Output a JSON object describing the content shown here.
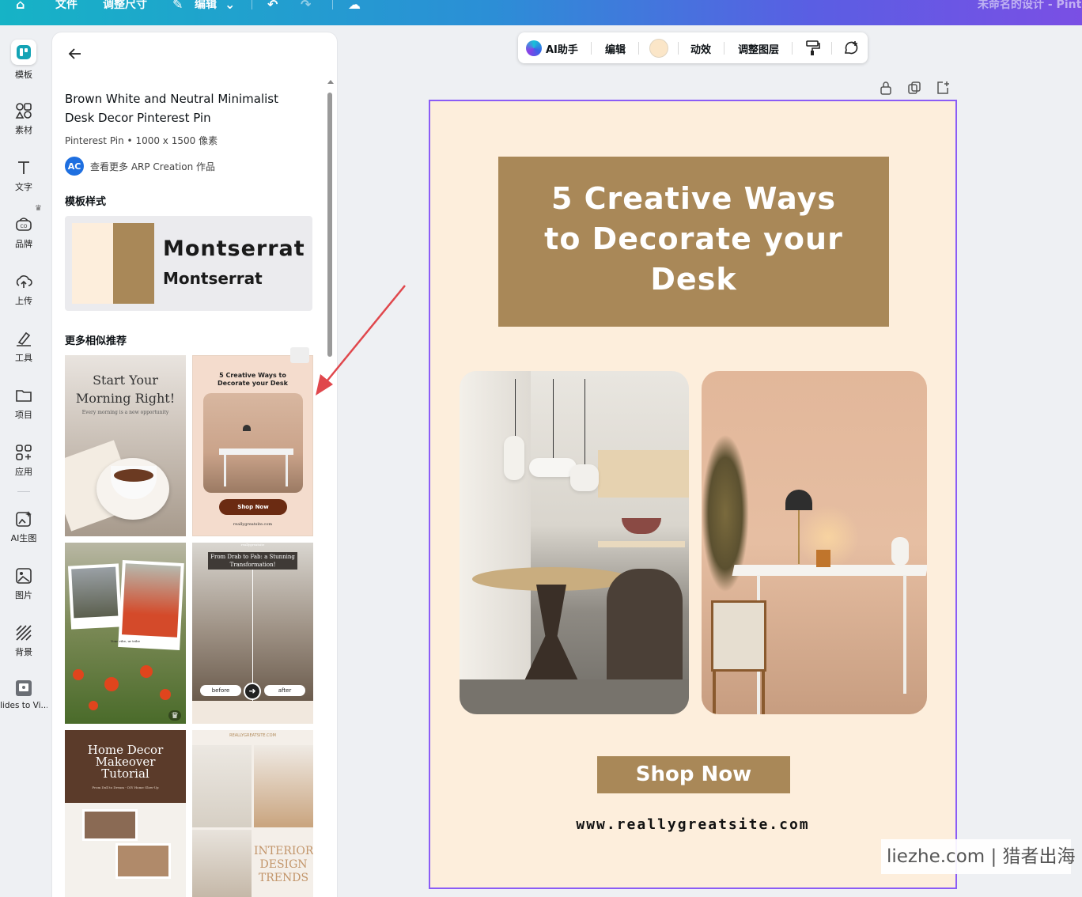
{
  "topbar": {
    "home_icon": "home-icon",
    "file": "文件",
    "resize": "调整尺寸",
    "edit": "编辑",
    "title": "未命名的设计 - Pinte"
  },
  "rail": [
    {
      "label": "模板",
      "icon": "templates-icon",
      "active": true
    },
    {
      "label": "素材",
      "icon": "elements-icon"
    },
    {
      "label": "文字",
      "icon": "text-icon"
    },
    {
      "label": "品牌",
      "icon": "brand-icon"
    },
    {
      "label": "上传",
      "icon": "upload-icon"
    },
    {
      "label": "工具",
      "icon": "tools-icon"
    },
    {
      "label": "项目",
      "icon": "projects-icon"
    },
    {
      "label": "应用",
      "icon": "apps-icon"
    },
    {
      "label": "AI生图",
      "icon": "ai-image-icon"
    },
    {
      "label": "图片",
      "icon": "photos-icon"
    },
    {
      "label": "背景",
      "icon": "background-icon"
    },
    {
      "label": "lides to Vi...",
      "icon": "slides-to-video-icon"
    }
  ],
  "panel": {
    "title": "Brown White and Neutral Minimalist Desk Decor Pinterest Pin",
    "meta": "Pinterest Pin • 1000 x 1500 像素",
    "avatar": "AC",
    "author": "查看更多 ARP Creation 作品",
    "style_heading": "模板样式",
    "font_big": "Montserrat",
    "font_small": "Montserrat",
    "swatches": [
      "#fdeedc",
      "#a98858"
    ],
    "more_heading": "更多相似推荐",
    "thumbs": {
      "t1_title": "Start Your Morning Right!",
      "t1_sub": "Every morning is a new opportunity",
      "t2_title": "5 Creative Ways to Decorate your Desk",
      "t2_btn": "Shop Now",
      "t2_url": "reallygreatsite.com",
      "t3_caption": "Your vibe, ur tribe",
      "t4_tag": "reallygreatsite",
      "t4_title": "From Drab to Fab: a Stunning Transformation!",
      "t4_before": "before",
      "t4_after": "after",
      "t5_title": "Home Decor Makeover Tutorial",
      "t5_sub": "From Dull to Dream - DIY Home Glow-Up",
      "t6_tag": "REALLYGREATSITE.COM",
      "t6_title": "INTERIOR DESIGN TRENDS"
    }
  },
  "canvas_toolbar": {
    "ai": "AI助手",
    "edit": "编辑",
    "color": "#fbe6c8",
    "animate": "动效",
    "layers": "调整图层"
  },
  "design": {
    "headline": [
      "5 Creative Ways",
      "to Decorate your",
      "Desk"
    ],
    "button": "Shop Now",
    "url": "www.reallygreatsite.com",
    "bg": "#fdeedc",
    "accent": "#a98858"
  },
  "watermark": "liezhe.com | 猎者出海"
}
